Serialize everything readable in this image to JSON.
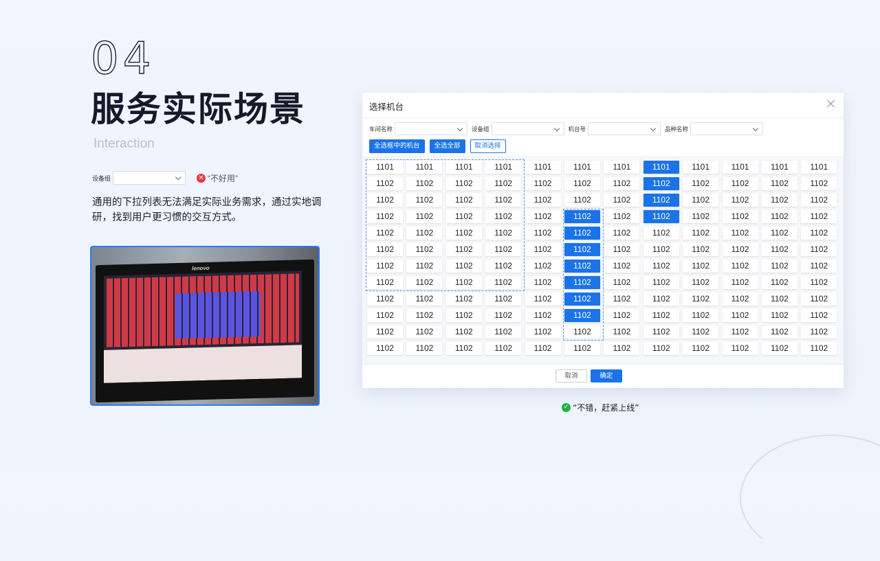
{
  "section_number": "04",
  "title": "服务实际场景",
  "subtitle": "Interaction",
  "bad_example": {
    "label": "设备组",
    "verdict_icon": "x-circle-icon",
    "verdict": "“不好用”",
    "color": "#e8343f"
  },
  "description": "通用的下拉列表无法满足实际业务需求，通过实地调研，找到用户更习惯的交互方式。",
  "photo": {
    "brand": "lenovo"
  },
  "dialog": {
    "title": "选择机台",
    "filters": [
      {
        "label": "车间名称",
        "value": ""
      },
      {
        "label": "设备组",
        "value": ""
      },
      {
        "label": "机台号",
        "value": ""
      },
      {
        "label": "品种名称",
        "value": ""
      }
    ],
    "buttons": {
      "select_in_box": "全选框中的机台",
      "select_all": "全选全部",
      "deselect": "取消选择"
    },
    "grid": {
      "columns": 12,
      "rows": [
        {
          "label": "1101",
          "selected_cols": [
            7
          ]
        },
        {
          "label": "1102",
          "selected_cols": [
            7
          ]
        },
        {
          "label": "1102",
          "selected_cols": [
            7
          ]
        },
        {
          "label": "1102",
          "selected_cols": [
            5,
            7
          ]
        },
        {
          "label": "1102",
          "selected_cols": [
            5
          ]
        },
        {
          "label": "1102",
          "selected_cols": [
            5
          ]
        },
        {
          "label": "1102",
          "selected_cols": [
            5
          ]
        },
        {
          "label": "1102",
          "selected_cols": [
            5
          ]
        },
        {
          "label": "1102",
          "selected_cols": [
            5
          ]
        },
        {
          "label": "1102",
          "selected_cols": [
            5
          ]
        },
        {
          "label": "1102",
          "selected_cols": []
        },
        {
          "label": "1102",
          "selected_cols": []
        }
      ]
    },
    "footer": {
      "cancel": "取消",
      "ok": "确定"
    },
    "accent": "#1a73e8"
  },
  "good_example": {
    "verdict_icon": "check-circle-icon",
    "verdict": "“不错，赶紧上线”",
    "color": "#20b04b"
  }
}
